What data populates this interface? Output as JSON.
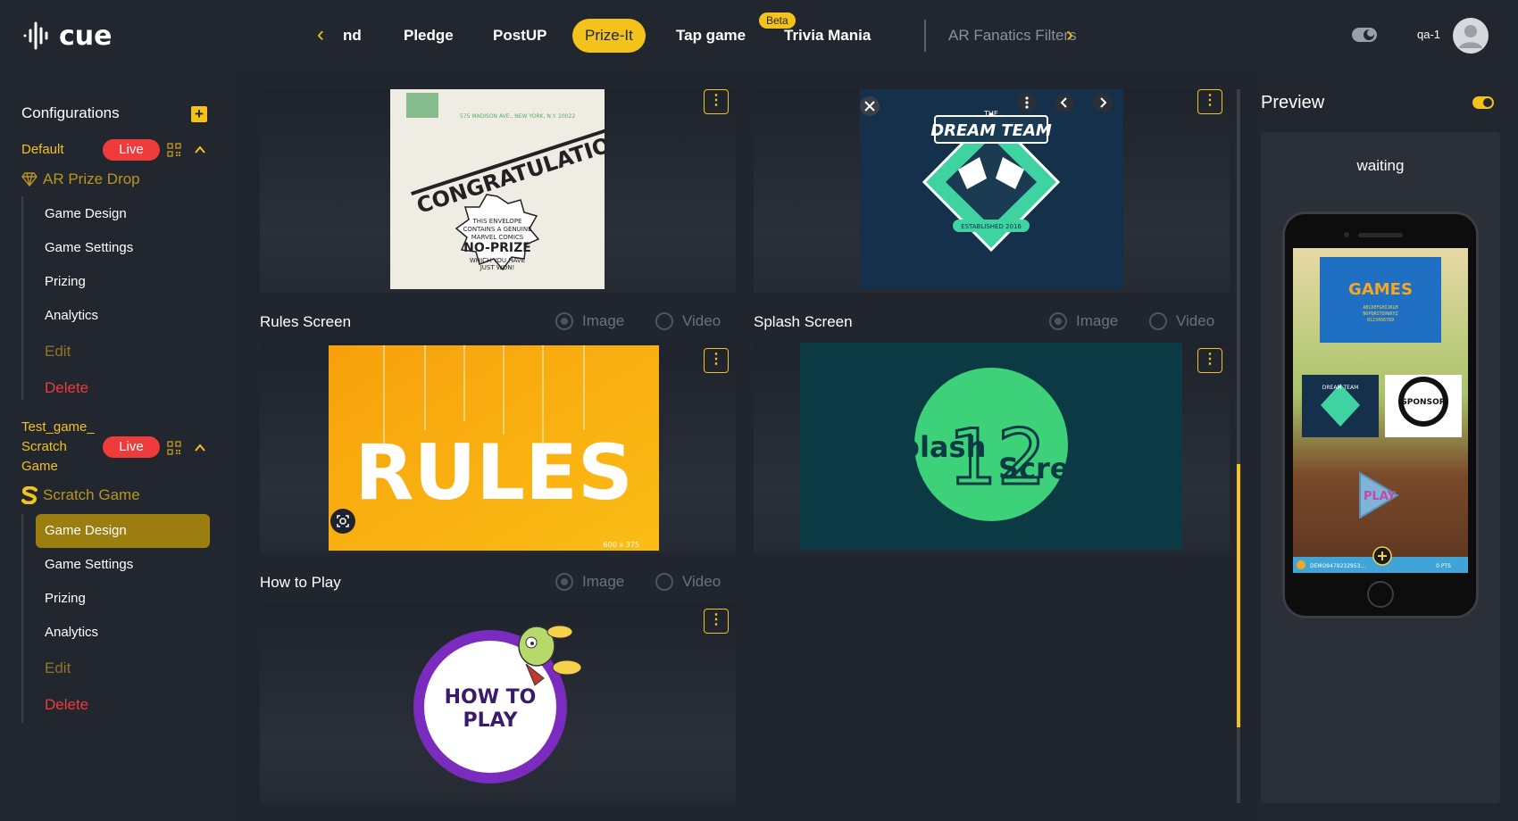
{
  "brand": {
    "name": "cue"
  },
  "nav": {
    "prev_icon": "chevron-left-icon",
    "next_icon": "chevron-right-icon",
    "tabs": [
      {
        "label": "nd"
      },
      {
        "label": "Pledge"
      },
      {
        "label": "PostUP"
      },
      {
        "label": "Prize-It"
      },
      {
        "label": "Tap game"
      },
      {
        "label": "Trivia Mania"
      },
      {
        "label": "AR Fanatics Filters"
      }
    ],
    "beta_label": "Beta"
  },
  "user": {
    "name": "qa-1"
  },
  "sidebar": {
    "title": "Configurations",
    "games": [
      {
        "name": "Default",
        "status": "Live",
        "type": "AR Prize Drop",
        "menu": [
          "Game Design",
          "Game Settings",
          "Prizing",
          "Analytics"
        ],
        "edit": "Edit",
        "delete": "Delete"
      },
      {
        "name": "Test_game_ Scratch Game",
        "name_lines": [
          "Test_game_",
          "Scratch",
          "Game"
        ],
        "status": "Live",
        "type": "Scratch Game",
        "menu": [
          "Game Design",
          "Game Settings",
          "Prizing",
          "Analytics"
        ],
        "active_item": "Game Design",
        "edit": "Edit",
        "delete": "Delete"
      }
    ]
  },
  "main": {
    "top_cards": [
      {
        "image_text": [
          "CONGRATULATIONS!",
          "THIS ENVELOPE CONTAINS A GENUINE MARVEL COMICS",
          "NO-PRIZE",
          "WHICH YOU HAVE JUST WON!",
          "575 MADISON AVE., NEW YORK, N.Y. 10022"
        ]
      },
      {
        "image_text": [
          "THE",
          "DREAM TEAM",
          "ESTABLISHED 2016"
        ]
      }
    ],
    "sections": [
      {
        "label": "Rules Screen",
        "option_image": "Image",
        "option_video": "Video",
        "image_text": "RULES",
        "size_tag": "600 x 375"
      },
      {
        "label": "Splash Screen",
        "option_image": "Image",
        "option_video": "Video",
        "image_text": [
          "Splash",
          "12",
          "Screen"
        ]
      },
      {
        "label": "How to Play",
        "option_image": "Image",
        "option_video": "Video",
        "image_text": [
          "HOW TO",
          "PLAY"
        ]
      }
    ]
  },
  "preview": {
    "title": "Preview",
    "status": "waiting",
    "phone": {
      "games_logo": "GAMES",
      "games_sub": [
        "ABCDEFGHIJKLM",
        "NOPQRSTUVWXYZ",
        "0123456789"
      ],
      "tile_left": "DREAM TEAM",
      "tile_right": "SPONSOR",
      "play": "PLAY",
      "footer_code": "DEMO9479232953...",
      "footer_pts": "0 PTS"
    }
  },
  "colors": {
    "accent": "#f3c21b",
    "live": "#ee3b3b",
    "bg": "#22262e",
    "active_menu": "#9b7d10"
  }
}
